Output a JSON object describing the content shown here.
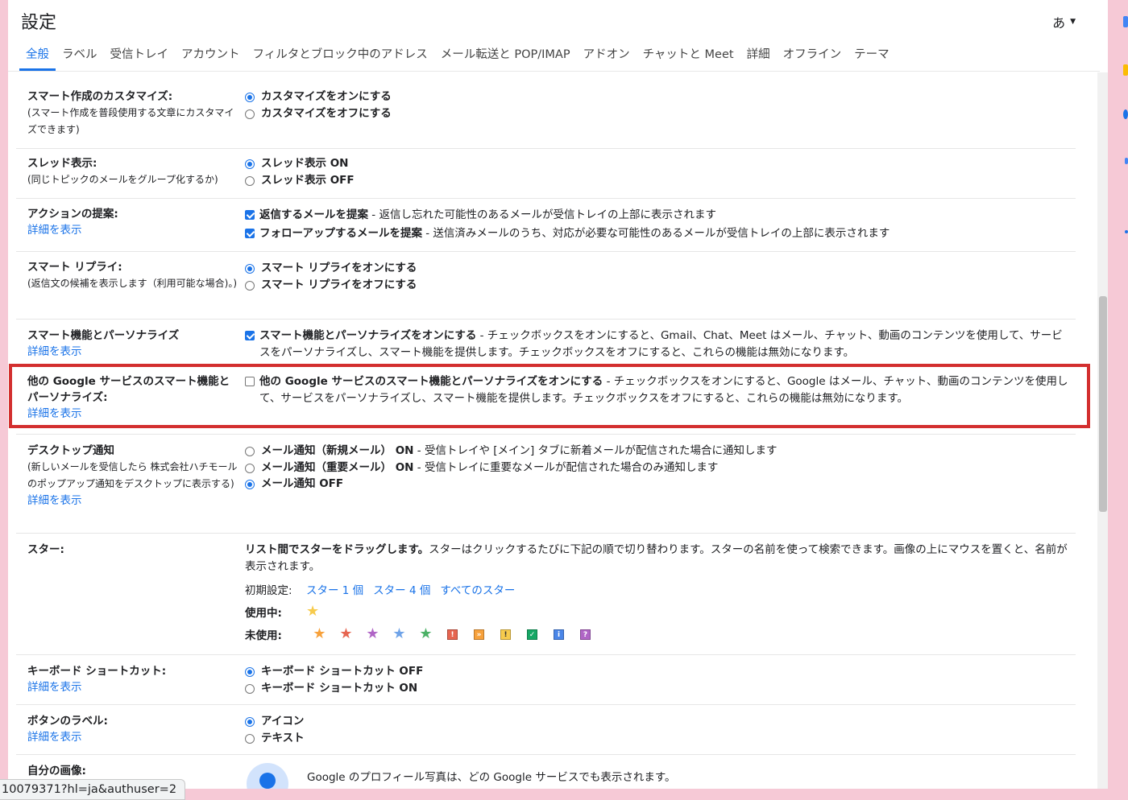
{
  "header": {
    "title": "設定",
    "ime": "あ"
  },
  "tabs": [
    "全般",
    "ラベル",
    "受信トレイ",
    "アカウント",
    "フィルタとブロック中のアドレス",
    "メール転送と POP/IMAP",
    "アドオン",
    "チャットと Meet",
    "詳細",
    "オフライン",
    "テーマ"
  ],
  "detail_link": "詳細を表示",
  "smart_compose": {
    "title": "スマート作成のカスタマイズ:",
    "sub": "(スマート作成を普段使用する文章にカスタマイズできます)",
    "on": "カスタマイズをオンにする",
    "off": "カスタマイズをオフにする"
  },
  "thread": {
    "title": "スレッド表示:",
    "sub": "(同じトピックのメールをグループ化するか)",
    "on": "スレッド表示 ON",
    "off": "スレッド表示 OFF"
  },
  "nudges": {
    "title": "アクションの提案:",
    "opt1_b": "返信するメールを提案",
    "opt1_d": " - 返信し忘れた可能性のあるメールが受信トレイの上部に表示されます",
    "opt2_b": "フォローアップするメールを提案",
    "opt2_d": " - 送信済みメールのうち、対応が必要な可能性のあるメールが受信トレイの上部に表示されます"
  },
  "smart_reply": {
    "title": "スマート リプライ:",
    "sub": "(返信文の候補を表示します（利用可能な場合)。)",
    "on": "スマート リプライをオンにする",
    "off": "スマート リプライをオフにする"
  },
  "smart_features": {
    "title": "スマート機能とパーソナライズ",
    "opt_b": "スマート機能とパーソナライズをオンにする",
    "opt_d": " - チェックボックスをオンにすると、Gmail、Chat、Meet はメール、チャット、動画のコンテンツを使用して、サービスをパーソナライズし、スマート機能を提供します。チェックボックスをオフにすると、これらの機能は無効になります。"
  },
  "other_google": {
    "title": "他の Google サービスのスマート機能とパーソナライズ:",
    "opt_b": "他の Google サービスのスマート機能とパーソナライズをオンにする",
    "opt_d": " - チェックボックスをオンにすると、Google はメール、チャット、動画のコンテンツを使用して、サービスをパーソナライズし、スマート機能を提供します。チェックボックスをオフにすると、これらの機能は無効になります。"
  },
  "desktop": {
    "title": "デスクトップ通知",
    "sub": "(新しいメールを受信したら 株式会社ハチモール のポップアップ通知をデスクトップに表示する)",
    "opt1_b": "メール通知（新規メール） ON",
    "opt1_d": " - 受信トレイや [メイン] タブに新着メールが配信された場合に通知します",
    "opt2_b": "メール通知（重要メール） ON",
    "opt2_d": " - 受信トレイに重要なメールが配信された場合のみ通知します",
    "opt3_b": "メール通知 OFF"
  },
  "stars": {
    "title": "スター:",
    "intro_b": "リスト間でスターをドラッグします。",
    "intro_d": "スターはクリックするたびに下記の順で切り替わります。スターの名前を使って検索できます。画像の上にマウスを置くと、名前が表示されます。",
    "preset_label": "初期設定:",
    "preset1": "スター 1 個",
    "preset4": "スター 4 個",
    "preset_all": "すべてのスター",
    "in_use": "使用中:",
    "not_in_use": "未使用:",
    "glyph": "★",
    "used_colors": [
      "#f7cb4d"
    ],
    "unused_colors": [
      "#f7a13b",
      "#e66550",
      "#b065c6",
      "#6fa3e8",
      "#4bb166"
    ],
    "squares": [
      {
        "glyph": "!",
        "bg": "#e66550",
        "fg": "#fff"
      },
      {
        "glyph": "»",
        "bg": "#f7a13b",
        "fg": "#fff"
      },
      {
        "glyph": "!",
        "bg": "#f7cb4d",
        "fg": "#333"
      },
      {
        "glyph": "✓",
        "bg": "#16a765",
        "fg": "#fff"
      },
      {
        "glyph": "i",
        "bg": "#4a86e8",
        "fg": "#fff"
      },
      {
        "glyph": "?",
        "bg": "#b065c6",
        "fg": "#fff"
      }
    ]
  },
  "shortcuts": {
    "title": "キーボード ショートカット:",
    "off": "キーボード ショートカット OFF",
    "on": "キーボード ショートカット ON"
  },
  "button_labels": {
    "title": "ボタンのラベル:",
    "icon": "アイコン",
    "text": "テキスト"
  },
  "picture": {
    "title": "自分の画像:",
    "desc": "Google のプロフィール写真は、どの Google サービスでも表示されます。"
  },
  "status_url": "10079371?hl=ja&authuser=2",
  "colors": {
    "accent": "#1a73e8",
    "highlight": "#d32f2f",
    "background": "#f6c9d6"
  }
}
